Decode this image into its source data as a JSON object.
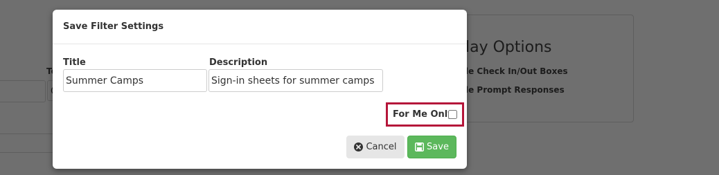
{
  "background": {
    "panel_title": "lay Options",
    "options": [
      "le Check In/Out Boxes",
      "le Prompt Responses"
    ],
    "label_to": "To",
    "input_char": "C"
  },
  "modal": {
    "title": "Save Filter Settings",
    "fields": {
      "title_label": "Title",
      "title_value": "Summer Camps",
      "description_label": "Description",
      "description_value": "Sign-in sheets for summer camps"
    },
    "for_me_only": {
      "label": "For Me Only",
      "checked": false
    },
    "buttons": {
      "cancel_label": "Cancel",
      "save_label": "Save"
    }
  },
  "colors": {
    "overlay": "#6f6f6f",
    "highlight_border": "#b5163a",
    "save_button": "#5cb85c",
    "cancel_button": "#e6e6e6"
  },
  "icons": {
    "cancel": "times-circle-icon",
    "save": "floppy-disk-icon"
  }
}
